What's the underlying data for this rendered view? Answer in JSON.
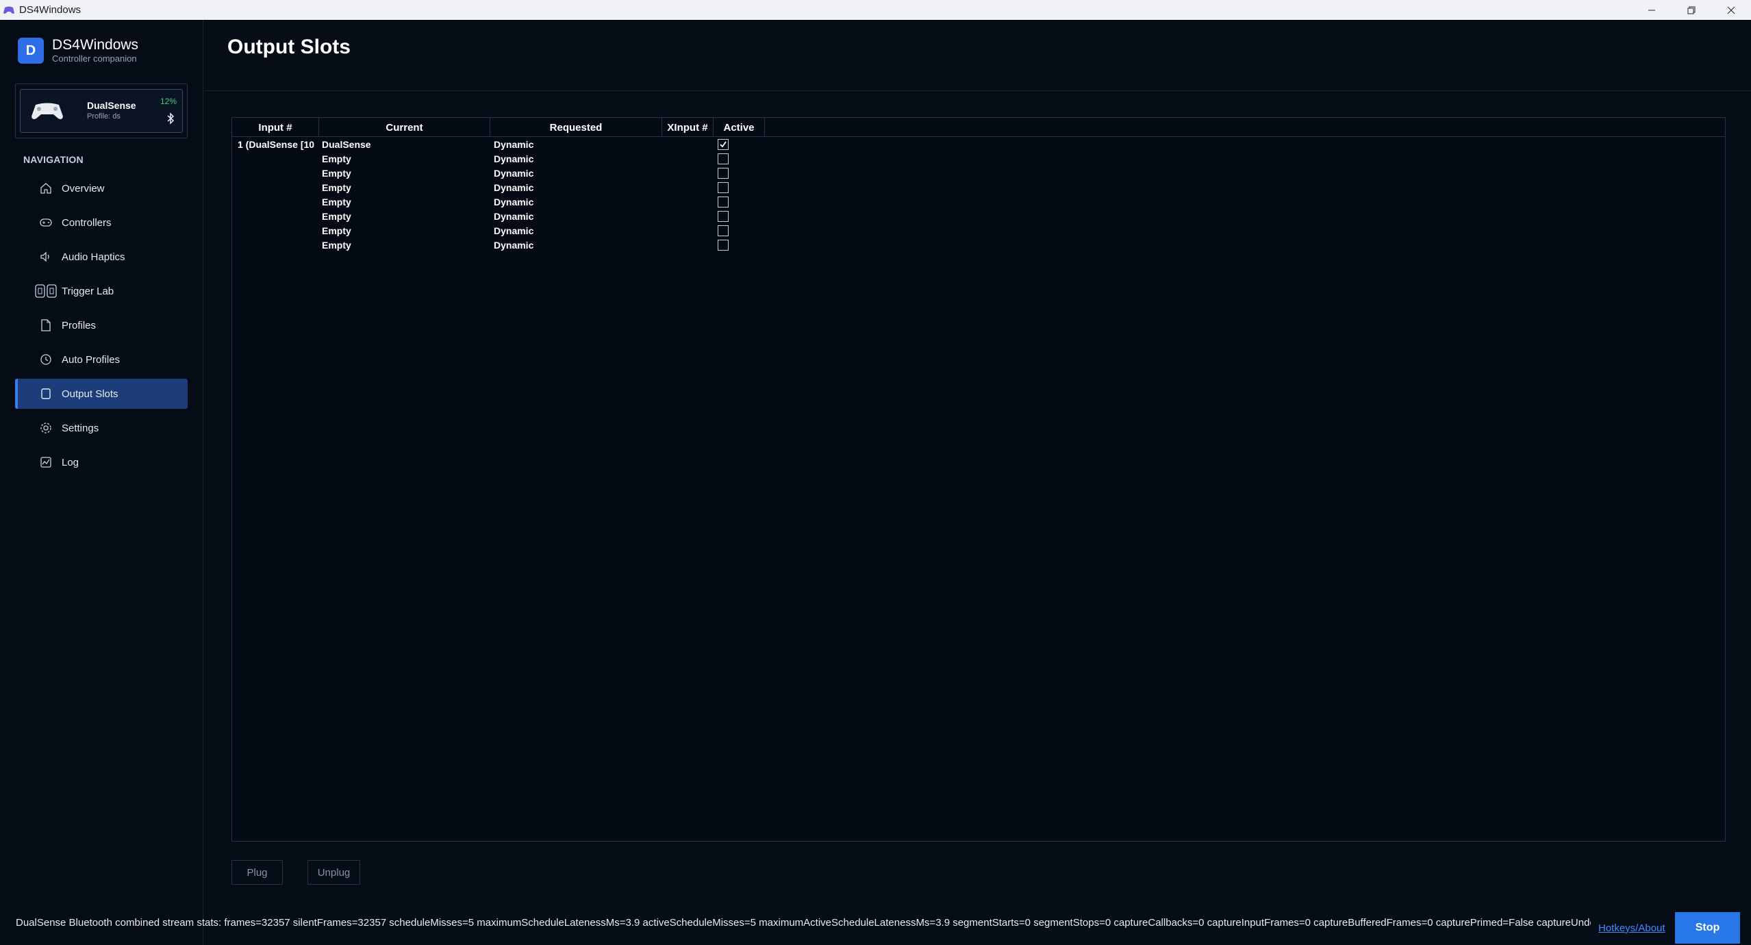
{
  "window": {
    "title": "DS4Windows",
    "controls": [
      "minimize-icon",
      "restore-icon",
      "close-icon"
    ]
  },
  "brand": {
    "logo_letter": "D",
    "name": "DS4Windows",
    "subtitle": "Controller companion"
  },
  "device": {
    "name": "DualSense",
    "profile": "Profile: ds",
    "battery": "12%",
    "connection_icon": "bluetooth-icon"
  },
  "sidebar": {
    "heading": "NAVIGATION",
    "items": [
      {
        "label": "Overview",
        "icon": "home-icon",
        "active": false
      },
      {
        "label": "Controllers",
        "icon": "gamepad-icon",
        "active": false
      },
      {
        "label": "Audio Haptics",
        "icon": "speaker-icon",
        "active": false
      },
      {
        "label": "Trigger Lab",
        "icon": "triggers-icon",
        "active": false
      },
      {
        "label": "Profiles",
        "icon": "document-icon",
        "active": false
      },
      {
        "label": "Auto Profiles",
        "icon": "clock-icon",
        "active": false
      },
      {
        "label": "Output Slots",
        "icon": "slot-icon",
        "active": true
      },
      {
        "label": "Settings",
        "icon": "gear-icon",
        "active": false
      },
      {
        "label": "Log",
        "icon": "chart-icon",
        "active": false
      }
    ]
  },
  "main": {
    "title": "Output Slots",
    "table": {
      "columns": [
        "Input #",
        "Current",
        "Requested",
        "XInput #",
        "Active"
      ],
      "rows": [
        {
          "input": "1 (DualSense [10",
          "current": "DualSense",
          "requested": "Dynamic",
          "xinput": "",
          "active": true
        },
        {
          "input": "",
          "current": "Empty",
          "requested": "Dynamic",
          "xinput": "",
          "active": false
        },
        {
          "input": "",
          "current": "Empty",
          "requested": "Dynamic",
          "xinput": "",
          "active": false
        },
        {
          "input": "",
          "current": "Empty",
          "requested": "Dynamic",
          "xinput": "",
          "active": false
        },
        {
          "input": "",
          "current": "Empty",
          "requested": "Dynamic",
          "xinput": "",
          "active": false
        },
        {
          "input": "",
          "current": "Empty",
          "requested": "Dynamic",
          "xinput": "",
          "active": false
        },
        {
          "input": "",
          "current": "Empty",
          "requested": "Dynamic",
          "xinput": "",
          "active": false
        },
        {
          "input": "",
          "current": "Empty",
          "requested": "Dynamic",
          "xinput": "",
          "active": false
        }
      ]
    },
    "plug_label": "Plug",
    "unplug_label": "Unplug"
  },
  "footer": {
    "status": "DualSense Bluetooth combined stream stats: frames=32357 silentFrames=32357 scheduleMisses=5 maximumScheduleLatenessMs=3.9 activeScheduleMisses=5 maximumActiveScheduleLatenessMs=3.9 segmentStarts=0 segmentStops=0 captureCallbacks=0 captureInputFrames=0 captureBufferedFrames=0 capturePrimed=False captureUnderruns=",
    "hotkeys_label": "Hotkeys/About",
    "stop_label": "Stop"
  },
  "colors": {
    "background": "#070d17",
    "accent": "#2e6ee6",
    "active_nav": "#1d3d7a",
    "battery": "#3fd07a",
    "link": "#3d8bff"
  }
}
